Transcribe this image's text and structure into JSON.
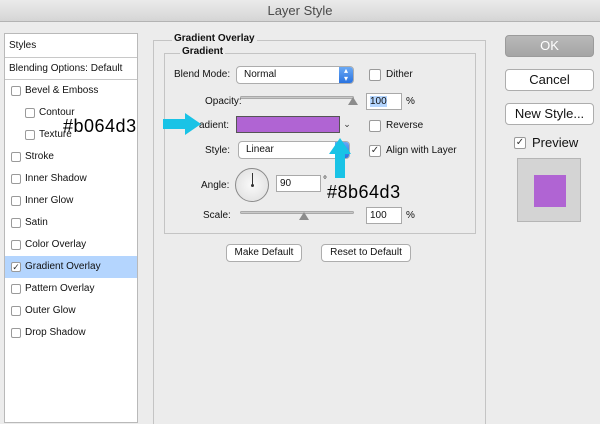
{
  "window": {
    "title": "Layer Style"
  },
  "styles": {
    "header": "Styles",
    "blending": "Blending Options: Default",
    "items": [
      {
        "label": "Bevel & Emboss",
        "checked": false,
        "indent": false
      },
      {
        "label": "Contour",
        "checked": false,
        "indent": true
      },
      {
        "label": "Texture",
        "checked": false,
        "indent": true
      },
      {
        "label": "Stroke",
        "checked": false,
        "indent": false
      },
      {
        "label": "Inner Shadow",
        "checked": false,
        "indent": false
      },
      {
        "label": "Inner Glow",
        "checked": false,
        "indent": false
      },
      {
        "label": "Satin",
        "checked": false,
        "indent": false
      },
      {
        "label": "Color Overlay",
        "checked": false,
        "indent": false
      },
      {
        "label": "Gradient Overlay",
        "checked": true,
        "indent": false
      },
      {
        "label": "Pattern Overlay",
        "checked": false,
        "indent": false
      },
      {
        "label": "Outer Glow",
        "checked": false,
        "indent": false
      },
      {
        "label": "Drop Shadow",
        "checked": false,
        "indent": false
      }
    ],
    "selected_index": 8
  },
  "panel": {
    "group_title": "Gradient Overlay",
    "inner_title": "Gradient",
    "blend_mode_label": "Blend Mode:",
    "blend_mode_value": "Normal",
    "dither_label": "Dither",
    "opacity_label": "Opacity:",
    "opacity_value": "100",
    "opacity_unit": "%",
    "opacity_level": 1.0,
    "gradient_label": "Gradient:",
    "gradient_label_visible": "adient:",
    "gradient_color": "#b064d3",
    "reverse_label": "Reverse",
    "style_label": "Style:",
    "style_value": "Linear",
    "align_label": "Align with Layer",
    "align_checked": true,
    "angle_label": "Angle:",
    "angle_value": "90",
    "angle_unit": "°",
    "scale_label": "Scale:",
    "scale_value": "100",
    "scale_unit": "%",
    "scale_level": 0.45,
    "make_default": "Make Default",
    "reset_default": "Reset to Default"
  },
  "buttons": {
    "ok": "OK",
    "cancel": "Cancel",
    "new_style": "New Style...",
    "preview_label": "Preview",
    "preview_checked": true
  },
  "annotations": {
    "left_color": "#b064d3",
    "bottom_color": "#8b64d3",
    "arrow_color": "#19c3e6"
  },
  "colors": {
    "selection": "#b4d5fe",
    "accent_blue": "#2a73e0"
  }
}
